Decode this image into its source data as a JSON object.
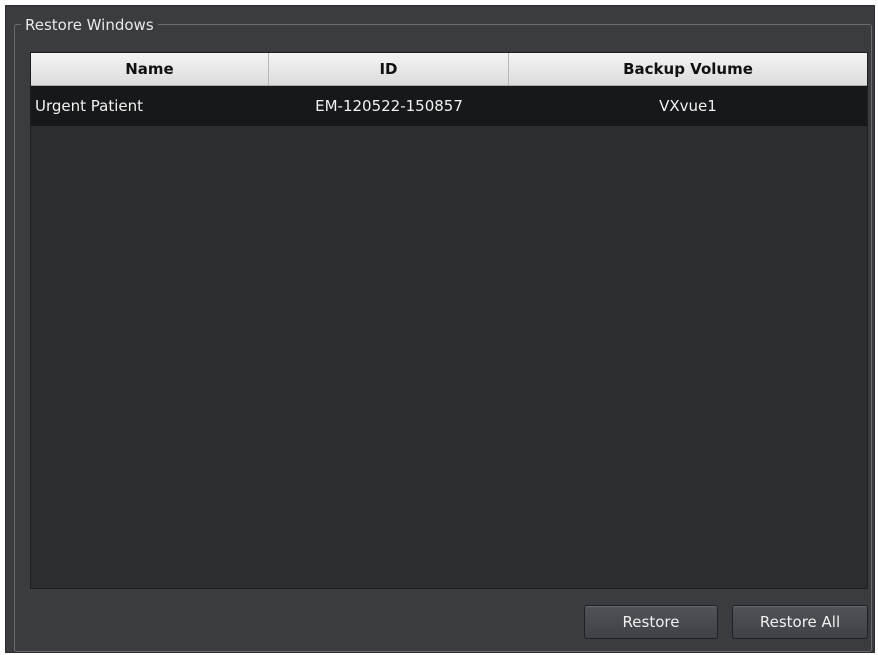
{
  "group": {
    "title": "Restore Windows"
  },
  "table": {
    "headers": [
      "Name",
      "ID",
      "Backup Volume"
    ],
    "rows": [
      {
        "name": "Urgent Patient",
        "id": "EM-120522-150857",
        "volume": "VXvue1"
      }
    ]
  },
  "buttons": {
    "restore": "Restore",
    "restore_all": "Restore All"
  }
}
